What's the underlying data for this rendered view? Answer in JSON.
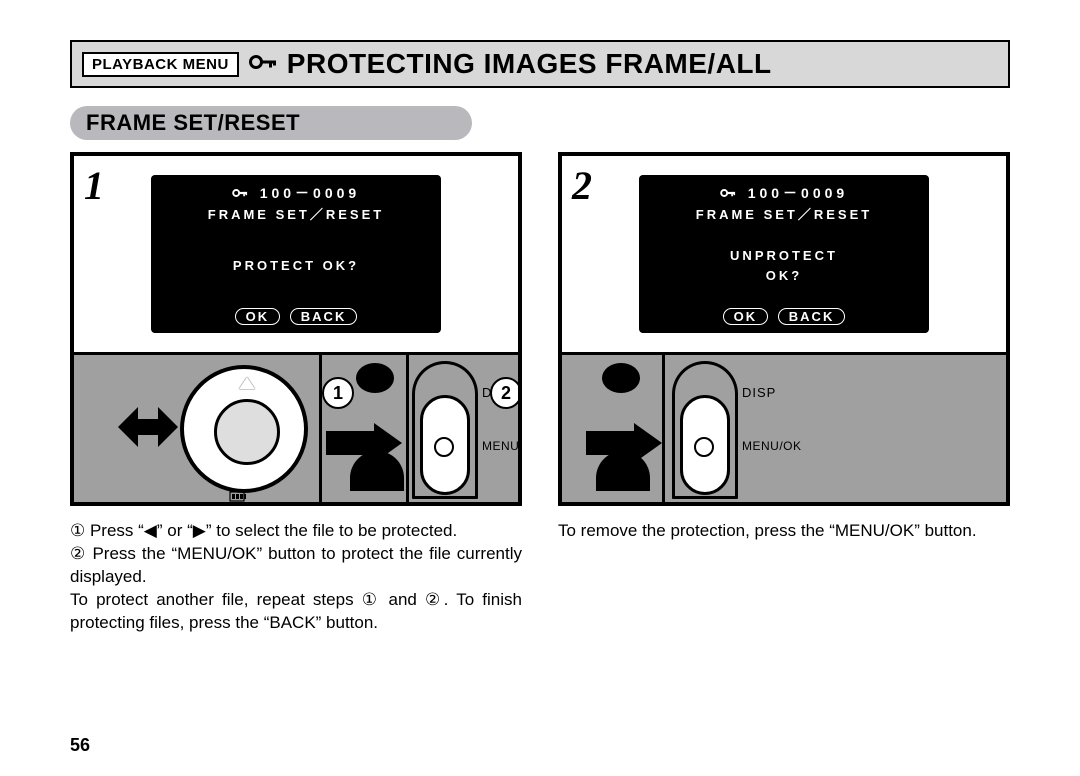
{
  "title": {
    "badge": "PLAYBACK MENU",
    "main": "PROTECTING IMAGES FRAME/ALL"
  },
  "subtitle": "FRAME SET/RESET",
  "step1": {
    "number": "1",
    "screen": {
      "file_no": "100－0009",
      "mode": "FRAME SET／RESET",
      "prompt_line1": "PROTECT OK?",
      "prompt_line2": "",
      "ok": "OK",
      "back": "BACK"
    },
    "labels": {
      "disp": "DISP",
      "menuok": "MENU/OK"
    },
    "callouts": {
      "c1": "1",
      "c2": "2"
    },
    "instructions": "① Press “◀” or “▶” to select the file to be protected.\n② Press the “MENU/OK” button to protect the file currently displayed.\nTo protect another file, repeat steps ① and ②. To finish protecting files, press the “BACK” button."
  },
  "step2": {
    "number": "2",
    "screen": {
      "file_no": "100－0009",
      "mode": "FRAME SET／RESET",
      "prompt_line1": "UNPROTECT",
      "prompt_line2": "OK?",
      "ok": "OK",
      "back": "BACK"
    },
    "labels": {
      "disp": "DISP",
      "menuok": "MENU/OK"
    },
    "instructions": "To remove the protection, press the “MENU/OK” button."
  },
  "page_number": "56"
}
